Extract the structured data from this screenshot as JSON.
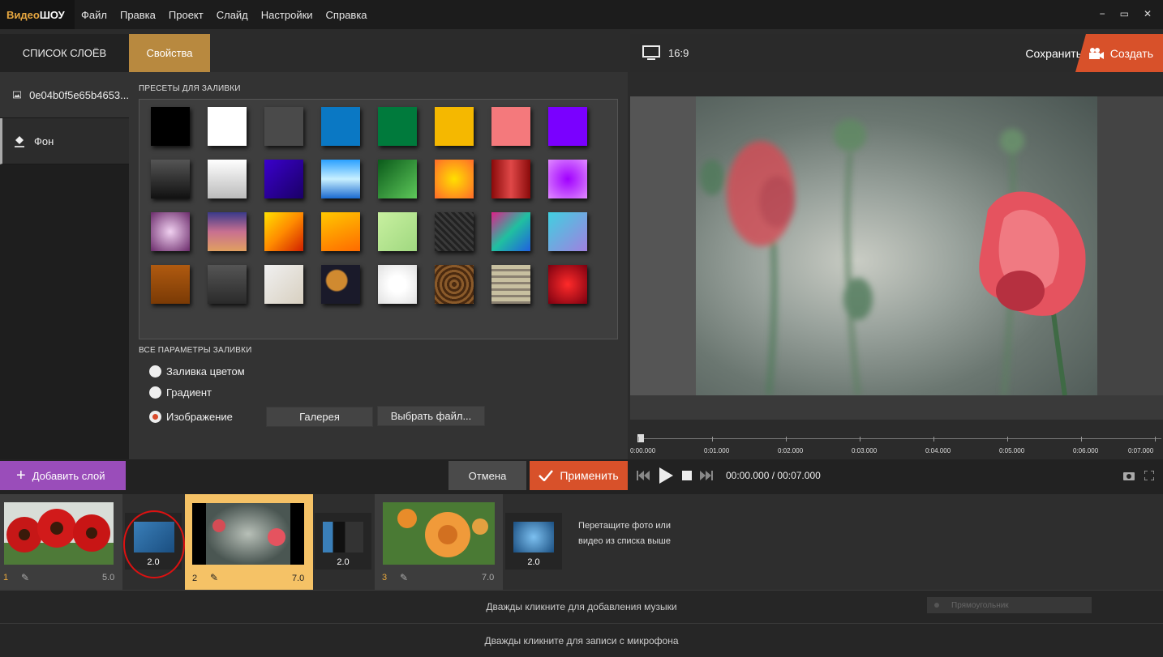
{
  "app": {
    "logo_part1": "Видео",
    "logo_part2": "ШОУ"
  },
  "menu": [
    "Файл",
    "Правка",
    "Проект",
    "Слайд",
    "Настройки",
    "Справка"
  ],
  "window_controls": [
    "−",
    "▭",
    "✕"
  ],
  "layers": {
    "header": "СПИСОК СЛОЁВ",
    "items": [
      {
        "label": "0e04b0f5e65b4653...",
        "icon": "image-icon"
      },
      {
        "label": "Фон",
        "icon": "paint-bucket-icon"
      }
    ]
  },
  "properties": {
    "tab": "Свойства",
    "presets_title": "ПРЕСЕТЫ ДЛЯ ЗАЛИВКИ",
    "fill_title": "ВСЕ ПАРАМЕТРЫ ЗАЛИВКИ",
    "options": [
      {
        "label": "Заливка цветом",
        "selected": false
      },
      {
        "label": "Градиент",
        "selected": false
      },
      {
        "label": "Изображение",
        "selected": true
      }
    ],
    "gallery_button": "Галерея",
    "choose_file_button": "Выбрать файл..."
  },
  "preview": {
    "aspect": "16:9",
    "save": "Сохранить",
    "create": "Создать"
  },
  "ruler": [
    "0:00.000",
    "0:01.000",
    "0:02.000",
    "0:03.000",
    "0:04.000",
    "0:05.000",
    "0:06.000",
    "0:07.000"
  ],
  "actions": {
    "add_layer": "Добавить слой",
    "cancel": "Отмена",
    "apply": "Применить"
  },
  "player": {
    "time": "00:00.000",
    "sep": " / ",
    "total": "00:07.000"
  },
  "storyboard": {
    "slides": [
      {
        "num": "1",
        "duration": "5.0"
      },
      {
        "num": "2",
        "duration": "7.0"
      },
      {
        "num": "3",
        "duration": "7.0"
      }
    ],
    "transitions": [
      "2.0",
      "2.0",
      "2.0"
    ],
    "drop_hint": "Перетащите фото или видео из списка выше"
  },
  "tracks": {
    "music": "Дважды кликните для добавления музыки",
    "mic": "Дважды кликните для записи с микрофона",
    "rect_label": "Прямоугольник"
  },
  "colors": {
    "accent_orange": "#d8512a",
    "tab_gold": "#b8893f",
    "add_layer_purple": "#9a4dba",
    "selected_slide": "#f5c266"
  }
}
